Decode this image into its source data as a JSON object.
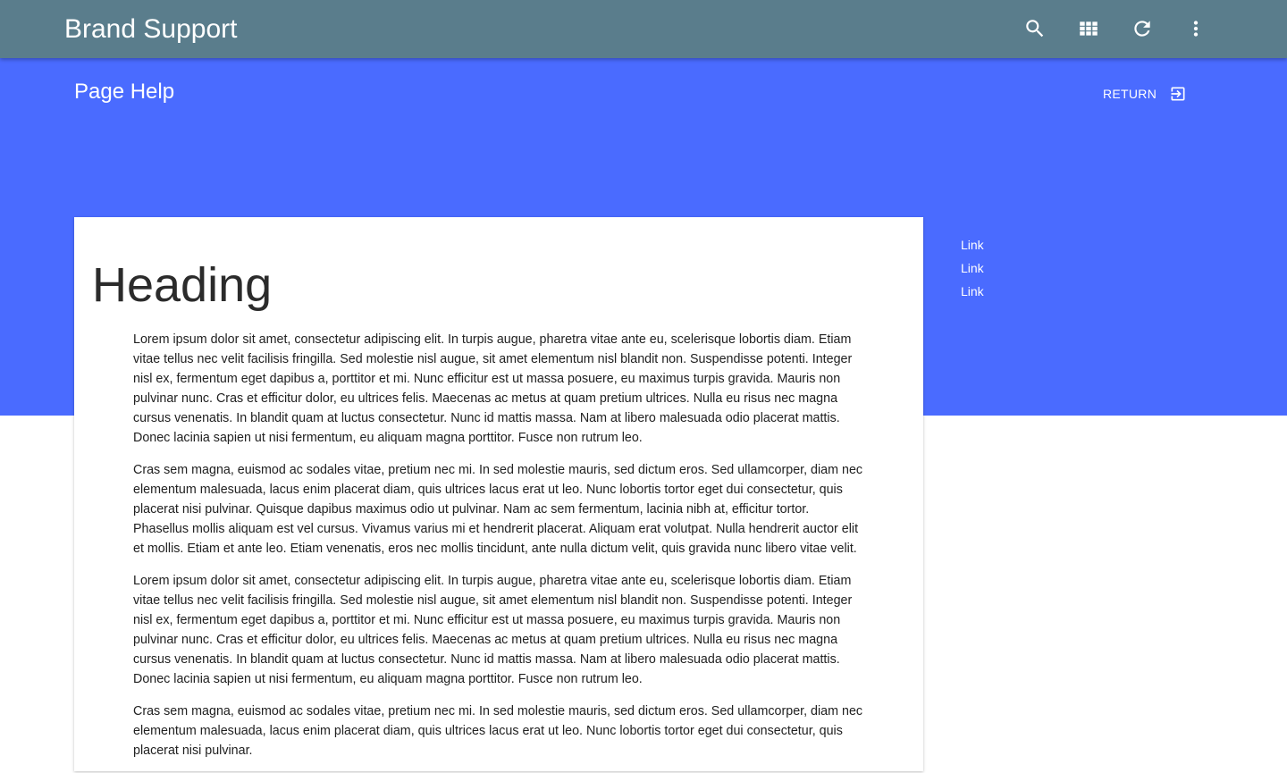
{
  "app": {
    "title": "Brand Support"
  },
  "toolbar": {
    "icons": [
      "search-icon",
      "apps-icon",
      "refresh-icon",
      "more-vert-icon"
    ]
  },
  "page": {
    "title": "Page Help",
    "return_label": "RETURN"
  },
  "sidebar": {
    "links": [
      "Link",
      "Link",
      "Link"
    ]
  },
  "content": {
    "heading": "Heading",
    "paragraphs": [
      "Lorem ipsum dolor sit amet, consectetur adipiscing elit. In turpis augue, pharetra vitae ante eu, scelerisque lobortis diam. Etiam vitae tellus nec velit facilisis fringilla. Sed molestie nisl augue, sit amet elementum nisl blandit non. Suspendisse potenti. Integer nisl ex, fermentum eget dapibus a, porttitor et mi. Nunc efficitur est ut massa posuere, eu maximus turpis gravida. Mauris non pulvinar nunc. Cras et efficitur dolor, eu ultrices felis. Maecenas ac metus at quam pretium ultrices. Nulla eu risus nec magna cursus venenatis. In blandit quam at luctus consectetur. Nunc id mattis massa. Nam at libero malesuada odio placerat mattis. Donec lacinia sapien ut nisi fermentum, eu aliquam magna porttitor. Fusce non rutrum leo.",
      "Cras sem magna, euismod ac sodales vitae, pretium nec mi. In sed molestie mauris, sed dictum eros. Sed ullamcorper, diam nec elementum malesuada, lacus enim placerat diam, quis ultrices lacus erat ut leo. Nunc lobortis tortor eget dui consectetur, quis placerat nisi pulvinar. Quisque dapibus maximus odio ut pulvinar. Nam ac sem fermentum, lacinia nibh at, efficitur tortor. Phasellus mollis aliquam est vel cursus. Vivamus varius mi et hendrerit placerat. Aliquam erat volutpat. Nulla hendrerit auctor elit et mollis. Etiam et ante leo. Etiam venenatis, eros nec mollis tincidunt, ante nulla dictum velit, quis gravida nunc libero vitae velit.",
      "Lorem ipsum dolor sit amet, consectetur adipiscing elit. In turpis augue, pharetra vitae ante eu, scelerisque lobortis diam. Etiam vitae tellus nec velit facilisis fringilla. Sed molestie nisl augue, sit amet elementum nisl blandit non. Suspendisse potenti. Integer nisl ex, fermentum eget dapibus a, porttitor et mi. Nunc efficitur est ut massa posuere, eu maximus turpis gravida. Mauris non pulvinar nunc. Cras et efficitur dolor, eu ultrices felis. Maecenas ac metus at quam pretium ultrices. Nulla eu risus nec magna cursus venenatis. In blandit quam at luctus consectetur. Nunc id mattis massa. Nam at libero malesuada odio placerat mattis. Donec lacinia sapien ut nisi fermentum, eu aliquam magna porttitor. Fusce non rutrum leo.",
      "Cras sem magna, euismod ac sodales vitae, pretium nec mi. In sed molestie mauris, sed dictum eros. Sed ullamcorper, diam nec elementum malesuada, lacus enim placerat diam, quis ultrices lacus erat ut leo. Nunc lobortis tortor eget dui consectetur, quis placerat nisi pulvinar."
    ]
  },
  "colors": {
    "topbar": "#5a7d8c",
    "banner": "#4a6bff",
    "card": "#ffffff",
    "text": "#212121"
  }
}
